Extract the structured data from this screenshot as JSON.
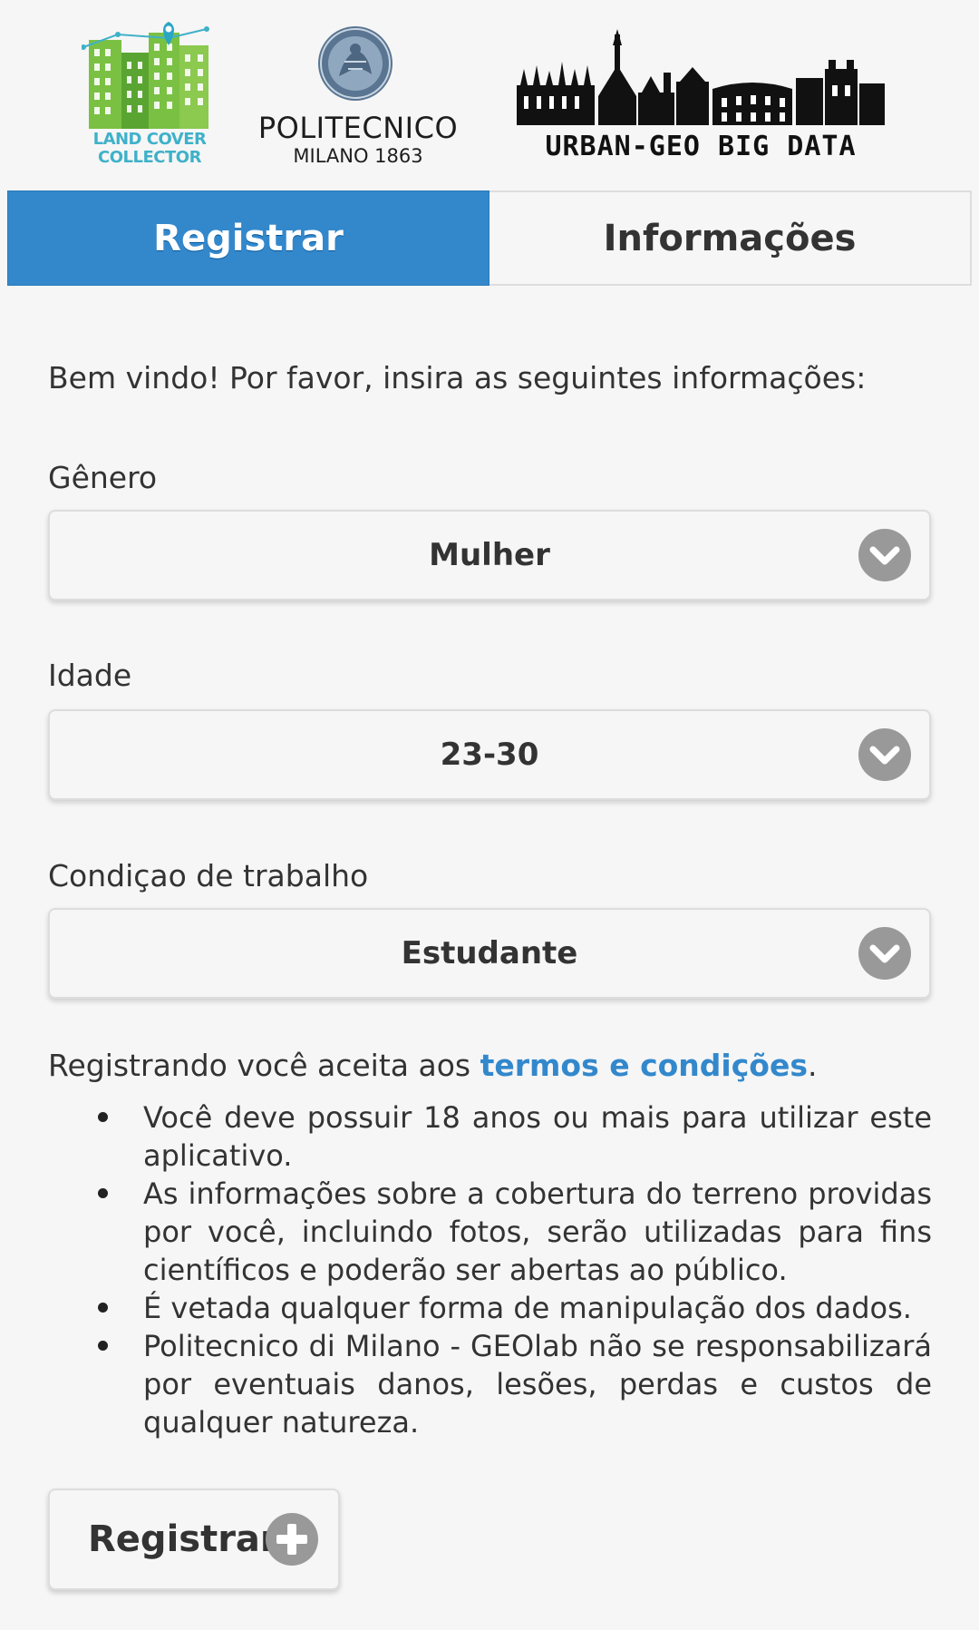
{
  "header": {
    "logo_left": "LAND COVER COLLECTOR",
    "logo_left_line1": "LAND COVER",
    "logo_left_line2": "COLLECTOR",
    "logo_center_name": "POLITECNICO",
    "logo_center_sub": "MILANO 1863",
    "logo_right": "URBAN-GEO BIG DATA"
  },
  "tabs": [
    {
      "label": "Registrar",
      "active": true
    },
    {
      "label": "Informações",
      "active": false
    }
  ],
  "form": {
    "intro": "Bem vindo! Por favor, insira as seguintes informações:",
    "fields": [
      {
        "label": "Gênero",
        "value": "Mulher"
      },
      {
        "label": "Idade",
        "value": "23-30"
      },
      {
        "label": "Condiçao de trabalho",
        "value": "Estudante"
      }
    ]
  },
  "terms": {
    "prefix": "Registrando você aceita aos ",
    "link": "termos e condições",
    "suffix": ".",
    "rules": [
      "Você deve possuir 18 anos ou mais para utilizar este aplicativo.",
      "As informações sobre a cobertura do terreno providas por você, incluindo fotos, serão utilizadas para fins científicos e poderão ser abertas ao público.",
      "É vetada qualquer forma de manipulação dos dados.",
      "Politecnico di Milano - GEOlab não se responsabilizará por eventuais danos, lesões, perdas e custos de qualquer natureza."
    ]
  },
  "submit": {
    "label": "Registrar",
    "icon": "plus-circle-icon"
  },
  "colors": {
    "accent": "#3388cc",
    "background": "#f6f6f6",
    "text": "#333333",
    "lcc_green": "#7ac143",
    "lcc_blue": "#3fb1c9"
  }
}
